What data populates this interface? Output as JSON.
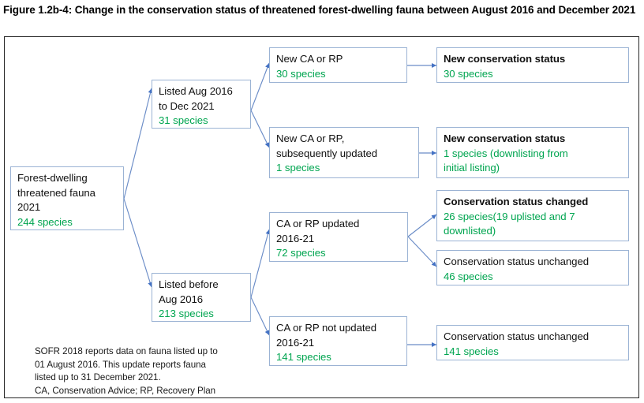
{
  "figure": {
    "title": "Figure 1.2b-4: Change in the conservation status of threatened forest-dwelling fauna between August 2016 and December 2021",
    "footnote": "SOFR 2018 reports data on fauna listed up to\n01 August 2016. This update reports fauna\nlisted up to 31 December 2021.\nCA, Conservation Advice; RP, Recovery Plan"
  },
  "colors": {
    "count_green": "#00A550",
    "box_border": "#9BB3D4",
    "connector_blue": "#4472C4",
    "frame_border": "#262626"
  },
  "nodes": {
    "root": {
      "header": "Forest-dwelling\nthreatened fauna\n2021",
      "count": "244 species"
    },
    "listed_new": {
      "header": "Listed Aug 2016\nto Dec 2021",
      "count": "31 species"
    },
    "listed_before": {
      "header": "Listed before\nAug 2016",
      "count": "213 species"
    },
    "new_ca_rp": {
      "header": "New CA or RP",
      "count": "30 species"
    },
    "new_ca_rp_updated": {
      "header": "New CA or RP,\nsubsequently updated",
      "count": "1 species"
    },
    "ca_rp_updated": {
      "header": "CA or RP updated\n2016-21",
      "count": "72 species"
    },
    "ca_rp_not_updated": {
      "header": "CA or RP not updated\n2016-21",
      "count": "141 species"
    },
    "new_status_30": {
      "header": "New conservation status",
      "count": "30 species"
    },
    "new_status_1": {
      "header": "New conservation status",
      "count": "1 species (downlisting from\ninitial listing)"
    },
    "status_changed_26": {
      "header": "Conservation status changed",
      "count": "26 species(19 uplisted and 7\ndownlisted)"
    },
    "status_unchanged_46": {
      "header": "Conservation status unchanged",
      "count": "46 species"
    },
    "status_unchanged_141": {
      "header": "Conservation status unchanged",
      "count": "141 species"
    }
  },
  "chart_data": {
    "type": "diagram",
    "title": "Change in the conservation status of threatened forest-dwelling fauna between August 2016 and December 2021",
    "root_total": 244,
    "levels": [
      {
        "label": "Forest-dwelling threatened fauna 2021",
        "value": 244
      },
      {
        "label": "Listed Aug 2016 to Dec 2021",
        "value": 31
      },
      {
        "label": "Listed before Aug 2016",
        "value": 213
      },
      {
        "label": "New CA or RP",
        "value": 30
      },
      {
        "label": "New CA or RP, subsequently updated",
        "value": 1
      },
      {
        "label": "CA or RP updated 2016-21",
        "value": 72
      },
      {
        "label": "CA or RP not updated 2016-21",
        "value": 141
      },
      {
        "label": "New conservation status",
        "value": 30
      },
      {
        "label": "New conservation status (downlisting from initial listing)",
        "value": 1
      },
      {
        "label": "Conservation status changed",
        "value": 26,
        "uplisted": 19,
        "downlisted": 7
      },
      {
        "label": "Conservation status unchanged",
        "value": 46
      },
      {
        "label": "Conservation status unchanged",
        "value": 141
      }
    ],
    "edges": [
      [
        "Forest-dwelling threatened fauna 2021",
        "Listed Aug 2016 to Dec 2021"
      ],
      [
        "Forest-dwelling threatened fauna 2021",
        "Listed before Aug 2016"
      ],
      [
        "Listed Aug 2016 to Dec 2021",
        "New CA or RP"
      ],
      [
        "Listed Aug 2016 to Dec 2021",
        "New CA or RP, subsequently updated"
      ],
      [
        "Listed before Aug 2016",
        "CA or RP updated 2016-21"
      ],
      [
        "Listed before Aug 2016",
        "CA or RP not updated 2016-21"
      ],
      [
        "New CA or RP",
        "New conservation status"
      ],
      [
        "New CA or RP, subsequently updated",
        "New conservation status (downlisting from initial listing)"
      ],
      [
        "CA or RP updated 2016-21",
        "Conservation status changed"
      ],
      [
        "CA or RP updated 2016-21",
        "Conservation status unchanged"
      ],
      [
        "CA or RP not updated 2016-21",
        "Conservation status unchanged"
      ]
    ]
  }
}
